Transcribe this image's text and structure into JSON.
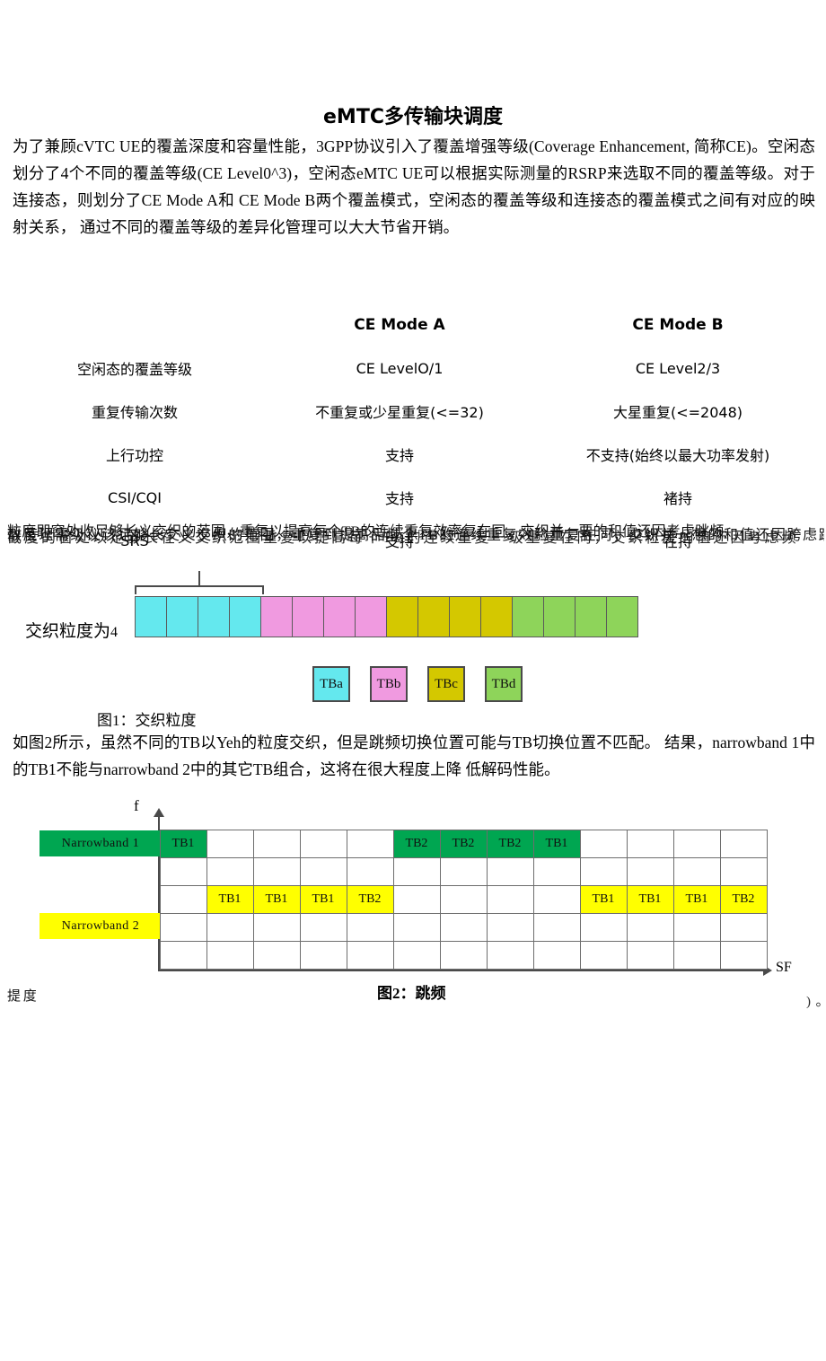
{
  "document": {
    "title": "eMTC多传输块调度",
    "intro": "为了兼顾cVTC UE的覆盖深度和容量性能，3GPP协议引入了覆盖增强等级(Coverage Enhancement, 简称CE)。空闲态划分了4个不同的覆盖等级(CE Level0^3)，空闲态eMTC UE可以根据实际测量的RSRP来选取不同的覆盖等级。对于连接态，则划分了CE Mode A和 CE Mode B两个覆盖模式，空闲态的覆盖等级和连接态的覆盖模式之间有对应的映射关系， 通过不同的覆盖等级的差异化管理可以大大节省开销。",
    "paragraph2": "如图2所示，虽然不同的TB以Yeh的粒度交织，但是跳频切换位置可能与TB切换位置不匹配。 结果，narrowband 1中的TB1不能与narrowband 2中的其它TB组合，这将在很大程度上降 低解码性能。"
  },
  "comparison_table": {
    "headers": [
      "",
      "CE Mode A",
      "CE Mode B"
    ],
    "rows": [
      {
        "label": "空闲态的覆盖等级",
        "mode_a": "CE LevelO/1",
        "mode_b": "CE Level2/3"
      },
      {
        "label": "重复传输次数",
        "mode_a": "不重复或少星重复(<=32)",
        "mode_b": "大星重复(<=2048)"
      },
      {
        "label": "上行功控",
        "mode_a": "支持",
        "mode_b": "不支持(始终以最大功率发射)"
      },
      {
        "label": "CSI/CQI",
        "mode_a": "支持",
        "mode_b": "褚持"
      },
      {
        "label": "SRS",
        "mode_a": "支持",
        "mode_b": "在持"
      }
    ]
  },
  "overlapped_text_top": {
    "line1": "粒度即窗处收足够长义交织的范围，重复以提高每个TB的连续重复效率复在同，交织并一要的和值还因考虑跳频",
    "line2": "散度理需级议该足够长交义交织的范围，重复到提高品域个TB的连续重复效验重复在同，交织并一想的和值还因跨虑跳频",
    "line3": "截度的窗处以足够长在义交织范围重复以提高每个TB的连续重复一级重复在同，交织粒度的值还因考虑频"
  },
  "overlapped_text_bottom": {
    "line1": "提度",
    "line2": ")。"
  },
  "figure1": {
    "caption": "图1：交织粒度",
    "granularity_label": "交织粒度为",
    "granularity_value": "4",
    "brace_span_cells": 4,
    "total_cells": 16,
    "blocks": [
      {
        "name": "TBa",
        "color": "#64e8ee",
        "cells": 4
      },
      {
        "name": "TBb",
        "color": "#f09ae0",
        "cells": 4
      },
      {
        "name": "TBc",
        "color": "#d4c800",
        "cells": 4
      },
      {
        "name": "TBd",
        "color": "#8ed45a",
        "cells": 4
      }
    ],
    "legend": [
      {
        "label": "TBa",
        "color": "#64e8ee"
      },
      {
        "label": "TBb",
        "color": "#f09ae0"
      },
      {
        "label": "TBc",
        "color": "#d4c800"
      },
      {
        "label": "TBd",
        "color": "#8ed45a"
      }
    ]
  },
  "figure2": {
    "caption": "图2：跳频",
    "axis_y_label": "f",
    "axis_x_label": "SF",
    "narrowband_labels": [
      {
        "text": "Narrowband 1",
        "color": "#00a651"
      },
      {
        "text": "Narrowband 2",
        "color": "#ffff00"
      }
    ],
    "grid": {
      "columns": 13,
      "rows": 5,
      "cells": [
        [
          {
            "t": "TB1",
            "c": "#00a651"
          },
          {
            "t": "",
            "c": ""
          },
          {
            "t": "",
            "c": ""
          },
          {
            "t": "",
            "c": ""
          },
          {
            "t": "",
            "c": ""
          },
          {
            "t": "TB2",
            "c": "#00a651"
          },
          {
            "t": "TB2",
            "c": "#00a651"
          },
          {
            "t": "TB2",
            "c": "#00a651"
          },
          {
            "t": "TB1",
            "c": "#00a651"
          },
          {
            "t": "",
            "c": ""
          },
          {
            "t": "",
            "c": ""
          },
          {
            "t": "",
            "c": ""
          },
          {
            "t": "",
            "c": ""
          }
        ],
        [
          {
            "t": "",
            "c": ""
          },
          {
            "t": "",
            "c": ""
          },
          {
            "t": "",
            "c": ""
          },
          {
            "t": "",
            "c": ""
          },
          {
            "t": "",
            "c": ""
          },
          {
            "t": "",
            "c": ""
          },
          {
            "t": "",
            "c": ""
          },
          {
            "t": "",
            "c": ""
          },
          {
            "t": "",
            "c": ""
          },
          {
            "t": "",
            "c": ""
          },
          {
            "t": "",
            "c": ""
          },
          {
            "t": "",
            "c": ""
          },
          {
            "t": "",
            "c": ""
          }
        ],
        [
          {
            "t": "",
            "c": ""
          },
          {
            "t": "TB1",
            "c": "#ffff00"
          },
          {
            "t": "TB1",
            "c": "#ffff00"
          },
          {
            "t": "TB1",
            "c": "#ffff00"
          },
          {
            "t": "TB2",
            "c": "#ffff00"
          },
          {
            "t": "",
            "c": ""
          },
          {
            "t": "",
            "c": ""
          },
          {
            "t": "",
            "c": ""
          },
          {
            "t": "",
            "c": ""
          },
          {
            "t": "TB1",
            "c": "#ffff00"
          },
          {
            "t": "TB1",
            "c": "#ffff00"
          },
          {
            "t": "TB1",
            "c": "#ffff00"
          },
          {
            "t": "TB2",
            "c": "#ffff00"
          }
        ],
        [
          {
            "t": "",
            "c": ""
          },
          {
            "t": "",
            "c": ""
          },
          {
            "t": "",
            "c": ""
          },
          {
            "t": "",
            "c": ""
          },
          {
            "t": "",
            "c": ""
          },
          {
            "t": "",
            "c": ""
          },
          {
            "t": "",
            "c": ""
          },
          {
            "t": "",
            "c": ""
          },
          {
            "t": "",
            "c": ""
          },
          {
            "t": "",
            "c": ""
          },
          {
            "t": "",
            "c": ""
          },
          {
            "t": "",
            "c": ""
          },
          {
            "t": "",
            "c": ""
          }
        ],
        [
          {
            "t": "",
            "c": ""
          },
          {
            "t": "",
            "c": ""
          },
          {
            "t": "",
            "c": ""
          },
          {
            "t": "",
            "c": ""
          },
          {
            "t": "",
            "c": ""
          },
          {
            "t": "",
            "c": ""
          },
          {
            "t": "",
            "c": ""
          },
          {
            "t": "",
            "c": ""
          },
          {
            "t": "",
            "c": ""
          },
          {
            "t": "",
            "c": ""
          },
          {
            "t": "",
            "c": ""
          },
          {
            "t": "",
            "c": ""
          },
          {
            "t": "",
            "c": ""
          }
        ]
      ]
    }
  }
}
